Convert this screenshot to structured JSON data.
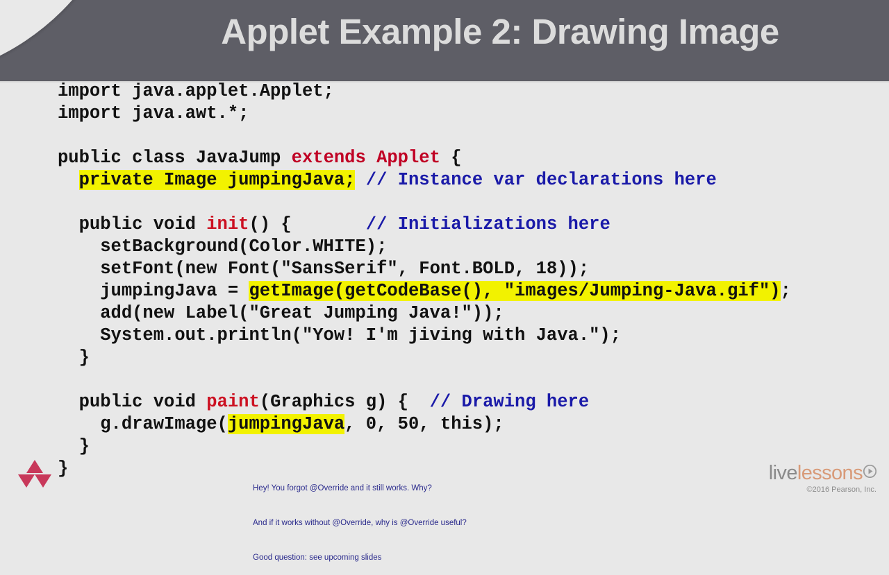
{
  "slide": {
    "title": "Applet Example 2: Drawing Image",
    "header_color": "#5e5e66",
    "background_color": "#e8e8e8",
    "title_color": "#dcdcdc"
  },
  "code": {
    "highlight_color": "#f2f200",
    "keyword_color": "#c00024",
    "comment_color": "#1a1aa8",
    "text_color": "#111111",
    "lines": [
      {
        "id": "l1",
        "segments": [
          {
            "text": "import java.applet.Applet;",
            "style": "plain"
          }
        ]
      },
      {
        "id": "l2",
        "segments": [
          {
            "text": "import java.awt.*;",
            "style": "plain"
          }
        ]
      },
      {
        "id": "l3",
        "segments": [
          {
            "text": "",
            "style": "plain"
          }
        ]
      },
      {
        "id": "l4",
        "segments": [
          {
            "text": "public class JavaJump ",
            "style": "plain"
          },
          {
            "text": "extends Applet",
            "style": "keyword"
          },
          {
            "text": " {",
            "style": "plain"
          }
        ]
      },
      {
        "id": "l5",
        "segments": [
          {
            "text": "  ",
            "style": "plain"
          },
          {
            "text": "private Image jumpingJava;",
            "style": "highlight"
          },
          {
            "text": " ",
            "style": "plain"
          },
          {
            "text": "// Instance var declarations here",
            "style": "comment"
          }
        ]
      },
      {
        "id": "l6",
        "segments": [
          {
            "text": "",
            "style": "plain"
          }
        ]
      },
      {
        "id": "l7",
        "segments": [
          {
            "text": "  public void ",
            "style": "plain"
          },
          {
            "text": "init",
            "style": "method"
          },
          {
            "text": "() {       ",
            "style": "plain"
          },
          {
            "text": "// Initializations here",
            "style": "comment"
          }
        ]
      },
      {
        "id": "l8",
        "segments": [
          {
            "text": "    setBackground(Color.WHITE);",
            "style": "plain"
          }
        ]
      },
      {
        "id": "l9",
        "segments": [
          {
            "text": "    setFont(new Font(\"SansSerif\", Font.BOLD, 18));",
            "style": "plain"
          }
        ]
      },
      {
        "id": "l10",
        "segments": [
          {
            "text": "    jumpingJava = ",
            "style": "plain"
          },
          {
            "text": "getImage(getCodeBase(), \"images/Jumping-Java.gif\")",
            "style": "highlight"
          },
          {
            "text": ";",
            "style": "plain"
          }
        ]
      },
      {
        "id": "l11",
        "segments": [
          {
            "text": "    add(new Label(\"Great Jumping Java!\"));",
            "style": "plain"
          }
        ]
      },
      {
        "id": "l12",
        "segments": [
          {
            "text": "    System.out.println(\"Yow! I'm jiving with Java.\");",
            "style": "plain"
          }
        ]
      },
      {
        "id": "l13",
        "segments": [
          {
            "text": "  }",
            "style": "plain"
          }
        ]
      },
      {
        "id": "l14",
        "segments": [
          {
            "text": "",
            "style": "plain"
          }
        ]
      },
      {
        "id": "l15",
        "segments": [
          {
            "text": "  public void ",
            "style": "plain"
          },
          {
            "text": "paint",
            "style": "method"
          },
          {
            "text": "(Graphics g) {  ",
            "style": "plain"
          },
          {
            "text": "// Drawing here",
            "style": "comment"
          }
        ]
      },
      {
        "id": "l16",
        "segments": [
          {
            "text": "    g.drawImage(",
            "style": "plain"
          },
          {
            "text": "jumpingJava",
            "style": "highlight"
          },
          {
            "text": ", 0, 50, this);",
            "style": "plain"
          }
        ]
      },
      {
        "id": "l17",
        "segments": [
          {
            "text": "  }",
            "style": "plain"
          }
        ]
      },
      {
        "id": "l18",
        "segments": [
          {
            "text": "}",
            "style": "plain"
          }
        ]
      }
    ]
  },
  "note": {
    "line1": "Hey! You forgot @Override and it still works. Why?",
    "line2": "And if it works without @Override, why is @Override useful?",
    "line3": "Good question: see upcoming slides",
    "color": "#2a2a8c"
  },
  "branding": {
    "triangle_color": "#c8385a",
    "logo_live": "live",
    "logo_lessons": "lessons",
    "copyright": "©2016 Pearson, Inc.",
    "live_color": "#8a8a8a",
    "lessons_color": "#d89a78"
  }
}
